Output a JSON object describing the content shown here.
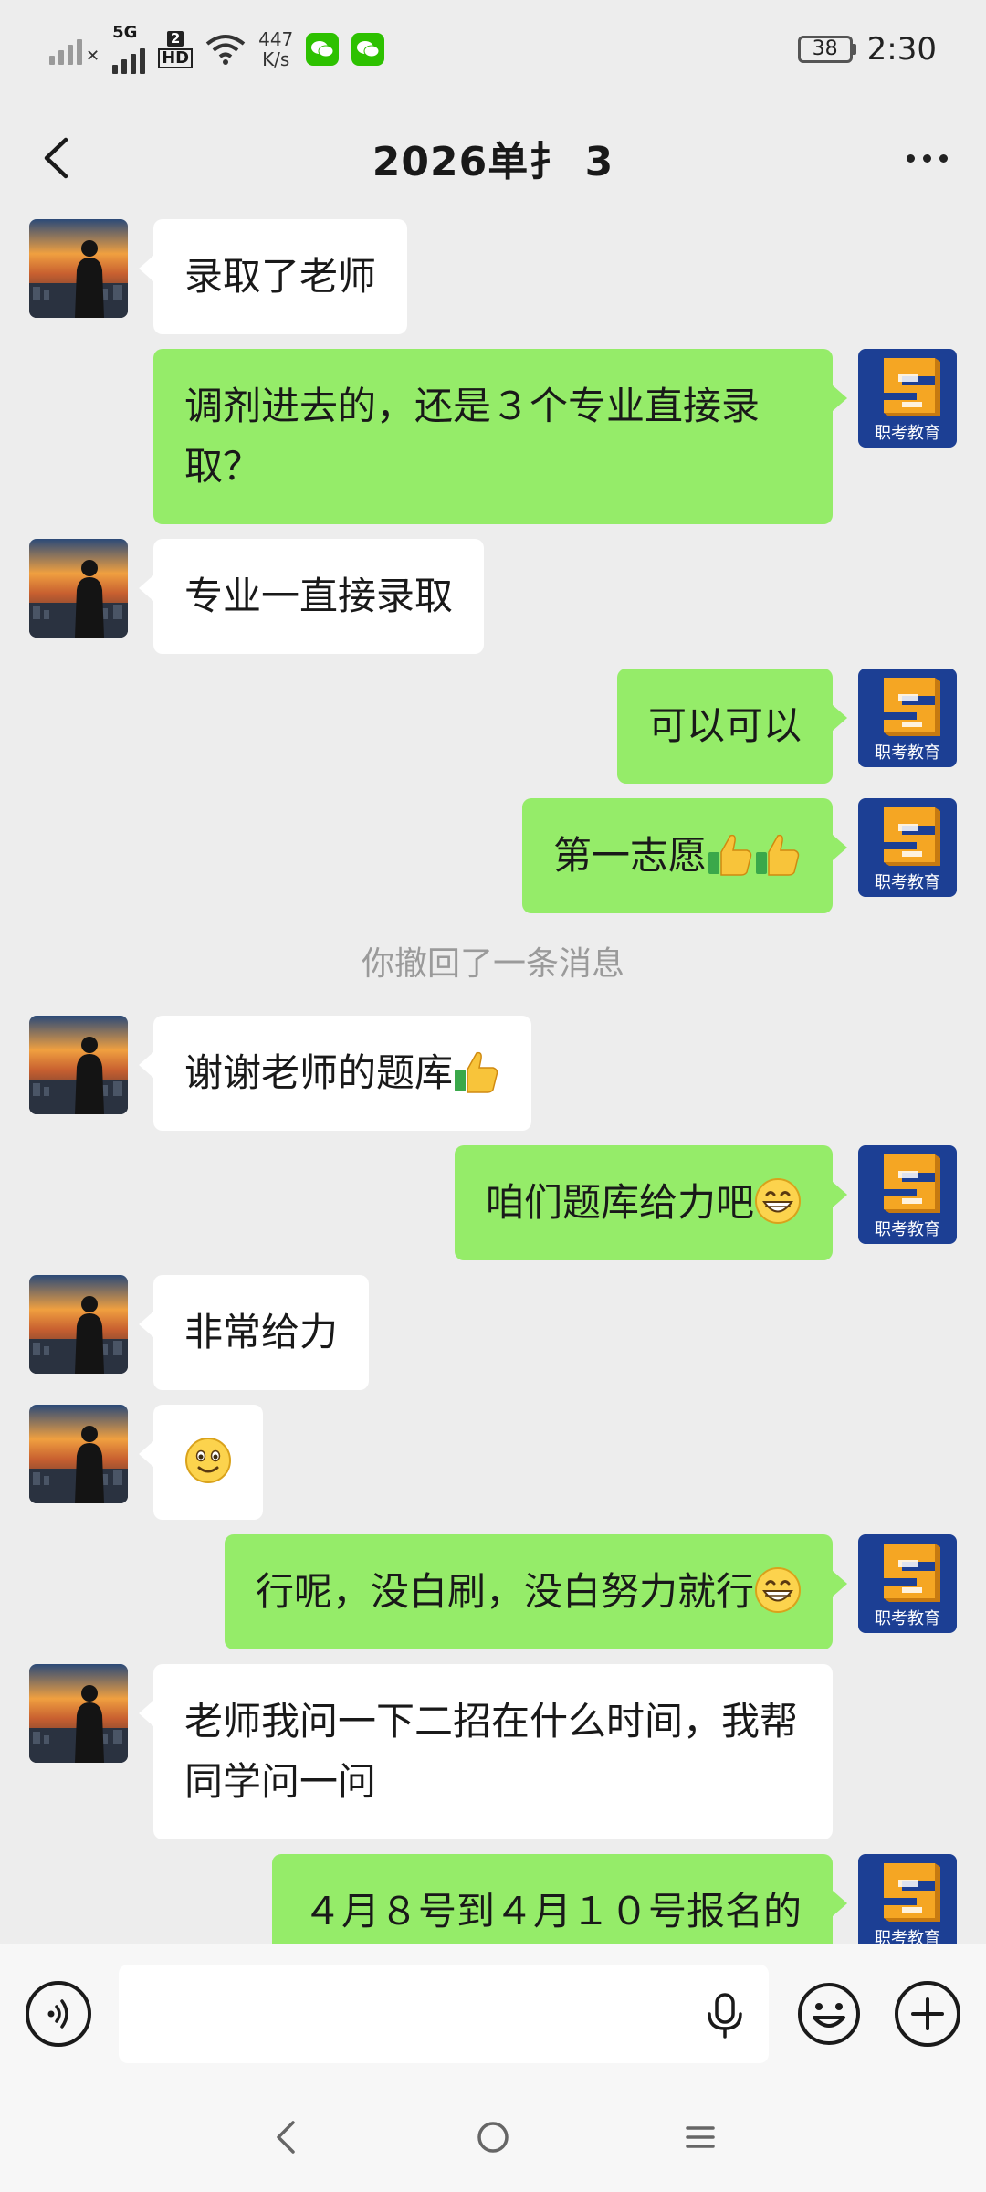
{
  "status_bar": {
    "net_speed_value": "447",
    "net_speed_unit": "K/s",
    "tag_5g": "5G",
    "sim_slot": "2",
    "hd_label": "HD",
    "battery": "38",
    "time": "2:30"
  },
  "header": {
    "title": "2026单扌                3"
  },
  "messages": [
    {
      "side": "left",
      "text": "录取了老师"
    },
    {
      "side": "right",
      "text": "调剂进去的，还是３个专业直接录取？"
    },
    {
      "side": "left",
      "text": "专业一直接录取"
    },
    {
      "side": "right",
      "text": "可以可以"
    },
    {
      "side": "right",
      "text": "第一志愿",
      "emojis": [
        "thumbs-up",
        "thumbs-up"
      ]
    },
    {
      "side": "system",
      "text": "你撤回了一条消息"
    },
    {
      "side": "left",
      "text": "谢谢老师的题库",
      "emojis": [
        "thumbs-up"
      ]
    },
    {
      "side": "right",
      "text": "咱们题库给力吧",
      "emojis": [
        "grin"
      ]
    },
    {
      "side": "left",
      "text": "非常给力"
    },
    {
      "side": "left",
      "text": "",
      "emojis": [
        "smile"
      ]
    },
    {
      "side": "right",
      "text": "行呢，没白刷，没白努力就行",
      "emojis": [
        "grin"
      ]
    },
    {
      "side": "left",
      "text": "老师我问一下二招在什么时间，我帮同学问一问"
    },
    {
      "side": "right",
      "text": "４月８号到４月１０号报名的"
    }
  ],
  "avatar_logo_text": "职考教育",
  "input": {
    "value": "",
    "placeholder": ""
  },
  "colors": {
    "background": "#ededed",
    "bubble_mine": "#95ec69",
    "bubble_other": "#ffffff",
    "system_text": "#9a9a9a",
    "logo_blue": "#1c3f94",
    "logo_orange": "#f5a623"
  }
}
